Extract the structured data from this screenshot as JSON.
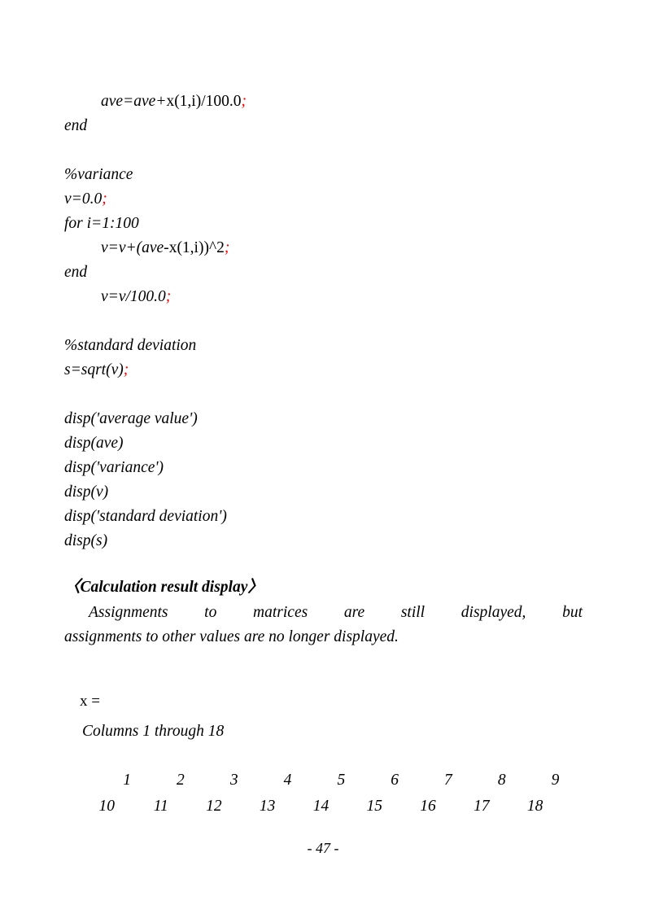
{
  "document": {
    "page_number_label": "- 47 -",
    "accent_color": "#ff0000",
    "text_color": "#000000",
    "background_color": "#ffffff"
  },
  "code": {
    "lines": [
      {
        "indent": 1,
        "parts": [
          {
            "t": "ave=ave+",
            "s": "i"
          },
          {
            "t": "x",
            "s": "u"
          },
          {
            "t": "(1,i)/100.0",
            "s": "u"
          },
          {
            "t": ";",
            "s": "r"
          }
        ]
      },
      {
        "indent": 0,
        "parts": [
          {
            "t": "end",
            "s": "i"
          }
        ]
      },
      {
        "indent": 0,
        "parts": []
      },
      {
        "indent": 0,
        "parts": [
          {
            "t": "%variance",
            "s": "i"
          }
        ]
      },
      {
        "indent": 0,
        "parts": [
          {
            "t": "v=0.0",
            "s": "i"
          },
          {
            "t": ";",
            "s": "r"
          }
        ]
      },
      {
        "indent": 0,
        "parts": [
          {
            "t": "for i=1:100",
            "s": "i"
          }
        ]
      },
      {
        "indent": 1,
        "parts": [
          {
            "t": "v=v+(ave-",
            "s": "i"
          },
          {
            "t": "x",
            "s": "u"
          },
          {
            "t": "(1,i))^2",
            "s": "u"
          },
          {
            "t": ";",
            "s": "r"
          }
        ]
      },
      {
        "indent": 0,
        "parts": [
          {
            "t": "end",
            "s": "i"
          }
        ]
      },
      {
        "indent": 1,
        "parts": [
          {
            "t": "v=v/100.0",
            "s": "i"
          },
          {
            "t": ";",
            "s": "r"
          }
        ]
      },
      {
        "indent": 0,
        "parts": []
      },
      {
        "indent": 0,
        "parts": [
          {
            "t": "%standard deviation",
            "s": "i"
          }
        ]
      },
      {
        "indent": 0,
        "parts": [
          {
            "t": "s=sqrt(v)",
            "s": "i"
          },
          {
            "t": ";",
            "s": "r"
          }
        ]
      },
      {
        "indent": 0,
        "parts": []
      },
      {
        "indent": 0,
        "parts": [
          {
            "t": "disp('average value')",
            "s": "i"
          }
        ]
      },
      {
        "indent": 0,
        "parts": [
          {
            "t": "disp(ave)",
            "s": "i"
          }
        ]
      },
      {
        "indent": 0,
        "parts": [
          {
            "t": "disp('variance')",
            "s": "i"
          }
        ]
      },
      {
        "indent": 0,
        "parts": [
          {
            "t": "disp(v)",
            "s": "i"
          }
        ]
      },
      {
        "indent": 0,
        "parts": [
          {
            "t": "disp('standard deviation')",
            "s": "i"
          }
        ]
      },
      {
        "indent": 0,
        "parts": [
          {
            "t": "disp(s)",
            "s": "i"
          }
        ]
      }
    ]
  },
  "section": {
    "heading": "〈Calculation result display〉",
    "paragraph_line_1": "Assignments to matrices are still displayed, but",
    "paragraph_line_2": "assignments to other values are no longer displayed."
  },
  "output": {
    "variable_label": "x =",
    "columns_label": "Columns 1 through 18",
    "rows": [
      [
        "1",
        "2",
        "3",
        "4",
        "5",
        "6",
        "7",
        "8",
        "9"
      ],
      [
        "10",
        "11",
        "12",
        "13",
        "14",
        "15",
        "16",
        "17",
        "18"
      ]
    ]
  }
}
